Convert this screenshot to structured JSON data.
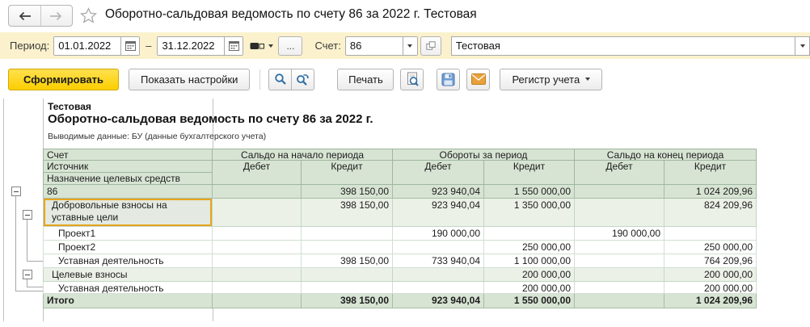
{
  "window": {
    "title": "Оборотно-сальдовая ведомость по счету 86 за 2022 г. Тестовая"
  },
  "toolbar": {
    "period_label": "Период:",
    "period_from": "01.01.2022",
    "period_dash": "–",
    "period_to": "31.12.2022",
    "more_button": "...",
    "account_label": "Счет:",
    "account_value": "86",
    "organization_value": "Тестовая"
  },
  "actions": {
    "generate": "Сформировать",
    "show_settings": "Показать настройки",
    "print": "Печать",
    "register": "Регистр учета"
  },
  "report": {
    "organization": "Тестовая",
    "title": "Оборотно-сальдовая ведомость по счету 86 за 2022 г.",
    "subtitle": "Выводимые данные: БУ (данные бухгалтерского учета)"
  },
  "table": {
    "row_headers": [
      "Счет",
      "Источник",
      "Назначение целевых средств"
    ],
    "groups": [
      "Сальдо на начало периода",
      "Обороты за период",
      "Сальдо на конец периода"
    ],
    "sub_headers": [
      "Дебет",
      "Кредит",
      "Дебет",
      "Кредит",
      "Дебет",
      "Кредит"
    ],
    "rows": [
      {
        "name": "86",
        "level": 1,
        "style": "group1",
        "cells": [
          "",
          "398 150,00",
          "923 940,04",
          "1 550 000,00",
          "",
          "1 024 209,96"
        ]
      },
      {
        "name": "Добровольные взносы на уставные цели",
        "level": 2,
        "style": "group2",
        "selected": true,
        "tall": true,
        "cells": [
          "",
          "398 150,00",
          "923 940,04",
          "1 350 000,00",
          "",
          "824 209,96"
        ]
      },
      {
        "name": "Проект1",
        "level": 3,
        "style": "detail",
        "cells": [
          "",
          "",
          "190 000,00",
          "",
          "190 000,00",
          ""
        ]
      },
      {
        "name": "Проект2",
        "level": 3,
        "style": "detail",
        "cells": [
          "",
          "",
          "",
          "250 000,00",
          "",
          "250 000,00"
        ]
      },
      {
        "name": "Уставная деятельность",
        "level": 3,
        "style": "detail",
        "cells": [
          "",
          "398 150,00",
          "733 940,04",
          "1 100 000,00",
          "",
          "764 209,96"
        ]
      },
      {
        "name": "Целевые взносы",
        "level": 2,
        "style": "group2",
        "cells": [
          "",
          "",
          "",
          "200 000,00",
          "",
          "200 000,00"
        ]
      },
      {
        "name": "Уставная деятельность",
        "level": 3,
        "style": "detail",
        "cells": [
          "",
          "",
          "",
          "200 000,00",
          "",
          "200 000,00"
        ]
      },
      {
        "name": "Итого",
        "level": 1,
        "style": "total",
        "cells": [
          "",
          "398 150,00",
          "923 940,04",
          "1 550 000,00",
          "",
          "1 024 209,96"
        ]
      }
    ]
  },
  "colors": {
    "toolbar_bg": "#fbf2cd",
    "generate_button": "#fbcf00",
    "header_green": "#d7e4d3",
    "group_green": "#ebf1e7",
    "selection_orange": "#e7a41c",
    "icon_blue": "#2e6da4",
    "envelope_orange": "#e9a13b"
  }
}
